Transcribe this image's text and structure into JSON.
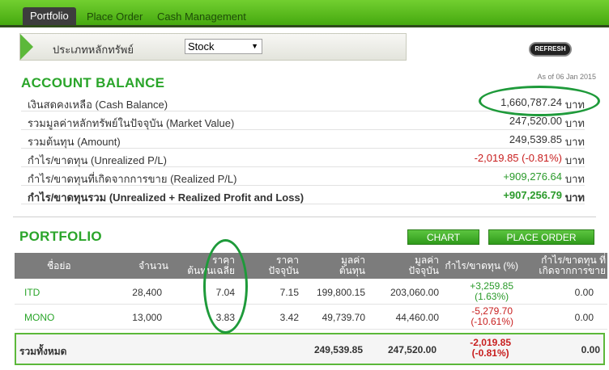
{
  "tabs": [
    {
      "label": "Portfolio",
      "active": true
    },
    {
      "label": "Place Order",
      "active": false
    },
    {
      "label": "Cash Management",
      "active": false
    }
  ],
  "filter": {
    "label": "ประเภทหลักทรัพย์",
    "selected": "Stock"
  },
  "refresh_label": "REFRESH",
  "account": {
    "title": "ACCOUNT BALANCE",
    "as_of": "As of 06 Jan 2015",
    "unit": "บาท",
    "rows": [
      {
        "label": "เงินสดคงเหลือ (Cash Balance)",
        "value": "1,660,787.24"
      },
      {
        "label": "รวมมูลค่าหลักทรัพย์ในปัจจุบัน (Market Value)",
        "value": "247,520.00"
      },
      {
        "label": "รวมต้นทุน (Amount)",
        "value": "249,539.85"
      },
      {
        "label": "กำไร/ขาดทุน (Unrealized P/L)",
        "value": "-2,019.85 (-0.81%)"
      },
      {
        "label": "กำไร/ขาดทุนที่เกิดจากการขาย (Realized P/L)",
        "value": "+909,276.64"
      },
      {
        "label": "กำไร/ขาดทุนรวม (Unrealized + Realized Profit and Loss)",
        "value": "+907,256.79"
      }
    ]
  },
  "portfolio": {
    "title": "PORTFOLIO",
    "chart_label": "CHART",
    "place_order_label": "PLACE ORDER",
    "headers": {
      "symbol": "ชื่อย่อ",
      "volume": "จำนวน",
      "avg_cost_1": "ราคา",
      "avg_cost_2": "ต้นทุนเฉลี่ย",
      "market_price_1": "ราคา",
      "market_price_2": "ปัจจุบัน",
      "cost_value_1": "มูลค่า",
      "cost_value_2": "ต้นทุน",
      "market_value_1": "มูลค่า",
      "market_value_2": "ปัจจุบัน",
      "unrealized": "กำไร/ขาดทุน (%)",
      "realized_1": "กำไร/ขาดทุน ที่",
      "realized_2": "เกิดจากการขาย"
    },
    "rows": [
      {
        "symbol": "ITD",
        "volume": "28,400",
        "avg_cost": "7.04",
        "market_price": "7.15",
        "cost_value": "199,800.15",
        "market_value": "203,060.00",
        "pl": "+3,259.85",
        "pl_pct": "(1.63%)",
        "realized": "0.00"
      },
      {
        "symbol": "MONO",
        "volume": "13,000",
        "avg_cost": "3.83",
        "market_price": "3.42",
        "cost_value": "49,739.70",
        "market_value": "44,460.00",
        "pl": "-5,279.70",
        "pl_pct": "(-10.61%)",
        "realized": "0.00"
      }
    ],
    "total": {
      "label": "รวมทั้งหมด",
      "cost_value": "249,539.85",
      "market_value": "247,520.00",
      "pl": "-2,019.85",
      "pl_pct": "(-0.81%)",
      "realized": "0.00"
    }
  },
  "colors": {
    "accent_green": "#2aa52a",
    "negative": "#c81e1e",
    "annotation": "#1e9a3a"
  }
}
